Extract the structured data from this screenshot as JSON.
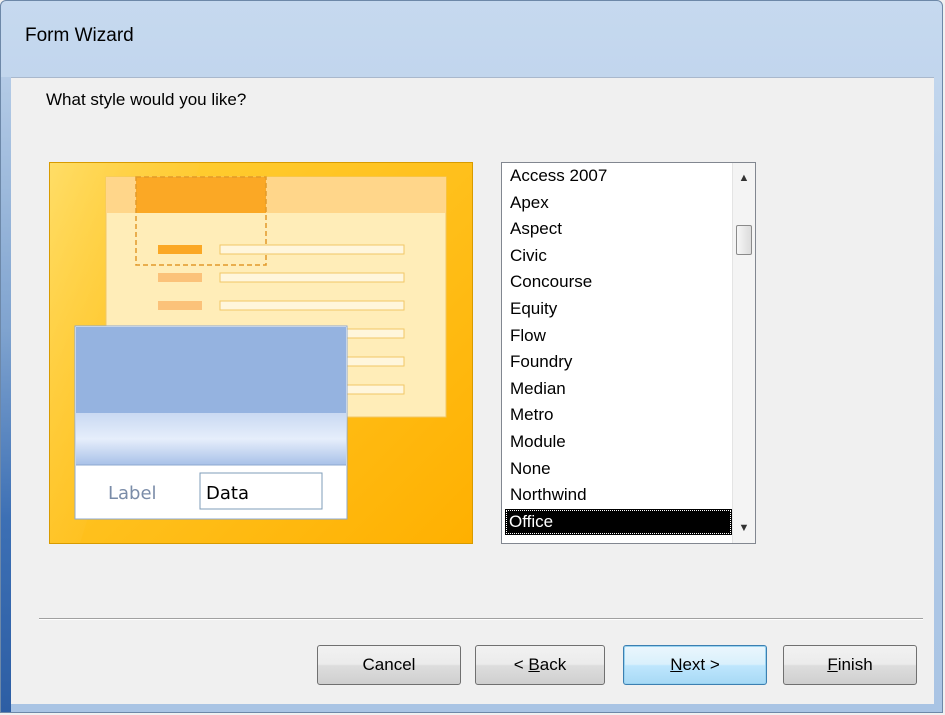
{
  "window": {
    "title": "Form Wizard"
  },
  "wizard": {
    "question": "What style would you like?"
  },
  "preview": {
    "label_text": "Label",
    "data_text": "Data"
  },
  "styles": {
    "items": [
      "Access 2007",
      "Apex",
      "Aspect",
      "Civic",
      "Concourse",
      "Equity",
      "Flow",
      "Foundry",
      "Median",
      "Metro",
      "Module",
      "None",
      "Northwind",
      "Office"
    ],
    "selected": "Office"
  },
  "buttons": {
    "cancel": "Cancel",
    "back": {
      "mnemonic": "B",
      "prefix": "< ",
      "rest": "ack"
    },
    "next": {
      "mnemonic": "N",
      "rest": "ext >"
    },
    "finish": {
      "mnemonic": "F",
      "rest": "inish"
    }
  },
  "colors": {
    "preview_gold": "#ffbf1a",
    "preview_blue": "#95b3e0",
    "selection": "#000000"
  }
}
